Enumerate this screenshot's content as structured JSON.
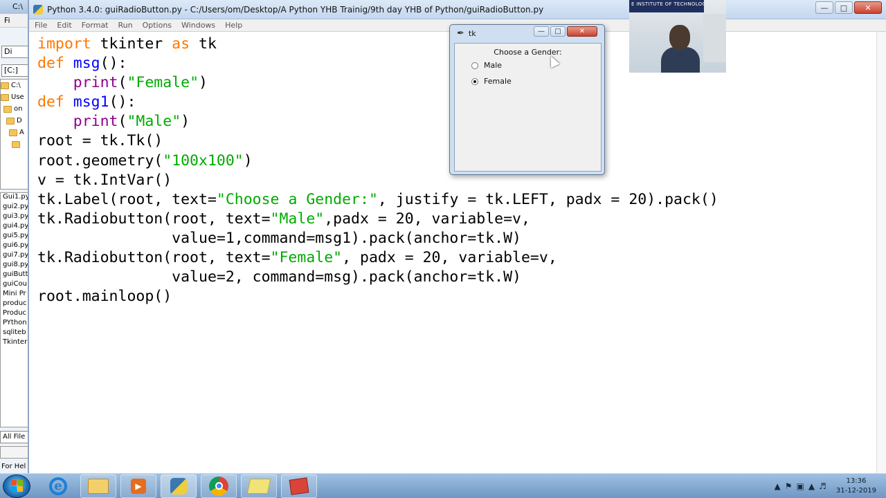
{
  "bg_explorer": {
    "title": "C:\\",
    "menu": "Fi",
    "combo1": "Di",
    "combo2": "[C:]",
    "tree": [
      "C:\\",
      "Use",
      "on",
      "D",
      "A",
      ""
    ],
    "files": [
      "Gui1.py",
      "gui2.py",
      "gui3.py",
      "gui4.py",
      "gui5.py",
      "gui6.py",
      "gui7.py",
      "gui8.py",
      "guiButt",
      "guiCou",
      "Mini Pr",
      "produc",
      "Produc",
      "PYthon",
      "sqliteb",
      "Tkinter"
    ],
    "filter": "All File",
    "status": "For Hel"
  },
  "idle": {
    "title": "Python 3.4.0: guiRadioButton.py - C:/Users/om/Desktop/A Python YHB Trainig/9th day YHB of Python/guiRadioButton.py",
    "menu": [
      "File",
      "Edit",
      "Format",
      "Run",
      "Options",
      "Windows",
      "Help"
    ],
    "code_lines": [
      [
        {
          "t": "import",
          "c": "kw"
        },
        {
          "t": " tkinter ",
          "c": ""
        },
        {
          "t": "as",
          "c": "kw"
        },
        {
          "t": " tk",
          "c": ""
        }
      ],
      [
        {
          "t": "def",
          "c": "kw"
        },
        {
          "t": " ",
          "c": ""
        },
        {
          "t": "msg",
          "c": "df"
        },
        {
          "t": "():",
          "c": ""
        }
      ],
      [
        {
          "t": "    ",
          "c": ""
        },
        {
          "t": "print",
          "c": "bi"
        },
        {
          "t": "(",
          "c": ""
        },
        {
          "t": "\"Female\"",
          "c": "st"
        },
        {
          "t": ")",
          "c": ""
        }
      ],
      [
        {
          "t": "def",
          "c": "kw"
        },
        {
          "t": " ",
          "c": ""
        },
        {
          "t": "msg1",
          "c": "df"
        },
        {
          "t": "():",
          "c": ""
        }
      ],
      [
        {
          "t": "    ",
          "c": ""
        },
        {
          "t": "print",
          "c": "bi"
        },
        {
          "t": "(",
          "c": ""
        },
        {
          "t": "\"Male\"",
          "c": "st"
        },
        {
          "t": ")",
          "c": ""
        }
      ],
      [
        {
          "t": "root = tk.Tk()",
          "c": ""
        }
      ],
      [
        {
          "t": "root.geometry(",
          "c": ""
        },
        {
          "t": "\"100x100\"",
          "c": "st"
        },
        {
          "t": ")",
          "c": ""
        }
      ],
      [
        {
          "t": "v = tk.IntVar()",
          "c": ""
        }
      ],
      [
        {
          "t": "tk.Label(root, text=",
          "c": ""
        },
        {
          "t": "\"Choose a Gender:\"",
          "c": "st"
        },
        {
          "t": ", justify = tk.LEFT, padx = 20).pack()",
          "c": ""
        }
      ],
      [
        {
          "t": "tk.Radiobutton(root, text=",
          "c": ""
        },
        {
          "t": "\"Male\"",
          "c": "st"
        },
        {
          "t": ",padx = 20, variable=v,",
          "c": ""
        }
      ],
      [
        {
          "t": "               value=1,command=msg1).pack(anchor=tk.W)",
          "c": ""
        }
      ],
      [
        {
          "t": "tk.Radiobutton(root, text=",
          "c": ""
        },
        {
          "t": "\"Female\"",
          "c": "st"
        },
        {
          "t": ", padx = 20, variable=v,",
          "c": ""
        }
      ],
      [
        {
          "t": "               value=2, command=msg).pack(anchor=tk.W)",
          "c": ""
        }
      ],
      [
        {
          "t": "root.mainloop()",
          "c": ""
        }
      ]
    ]
  },
  "tk_window": {
    "title": "tk",
    "label": "Choose a Gender:",
    "options": [
      {
        "label": "Male",
        "selected": false
      },
      {
        "label": "Female",
        "selected": true
      }
    ]
  },
  "webcam": {
    "banner": "E INSTITUTE OF TECHNOLOGY"
  },
  "taskbar": {
    "apps": [
      "internet-explorer",
      "file-explorer",
      "media-player",
      "python-idle",
      "chrome",
      "sticky-notes",
      "package-app"
    ],
    "clock_time": "13:36",
    "clock_date": "31-12-2019"
  },
  "colors": {
    "keyword": "#ff7700",
    "builtin": "#900090",
    "string": "#00aa00",
    "definition": "#0000ff"
  }
}
